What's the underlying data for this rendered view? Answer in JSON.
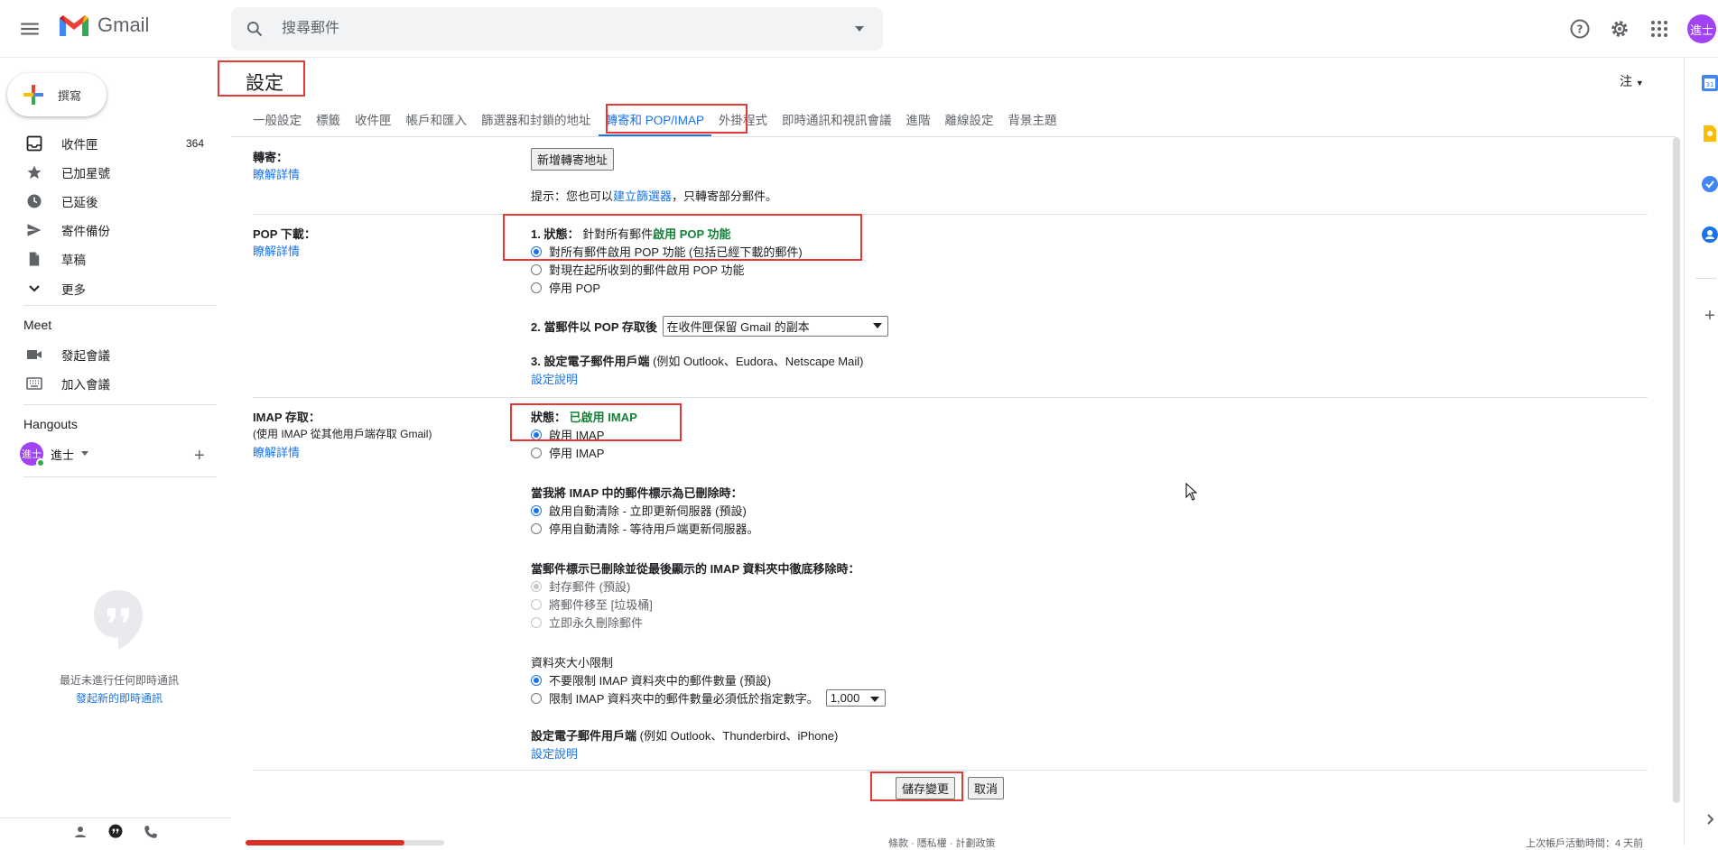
{
  "header": {
    "app_name": "Gmail",
    "search_placeholder": "搜尋郵件",
    "avatar_text": "進士"
  },
  "compose": {
    "label": "撰寫"
  },
  "nav": {
    "items": [
      {
        "label": "收件匣",
        "count": "364",
        "icon": "inbox-icon"
      },
      {
        "label": "已加星號",
        "count": "",
        "icon": "star-icon"
      },
      {
        "label": "已延後",
        "count": "",
        "icon": "clock-icon"
      },
      {
        "label": "寄件備份",
        "count": "",
        "icon": "send-icon"
      },
      {
        "label": "草稿",
        "count": "",
        "icon": "draft-icon"
      },
      {
        "label": "更多",
        "count": "",
        "icon": "chevron-down-icon"
      }
    ],
    "meet_title": "Meet",
    "meet_items": [
      {
        "label": "發起會議",
        "icon": "video-icon"
      },
      {
        "label": "加入會議",
        "icon": "keyboard-icon"
      }
    ],
    "hangouts_title": "Hangouts",
    "hangout_user": "進士",
    "hangout_avatar": "進士",
    "hangout_empty_text": "最近未進行任何即時通訊",
    "hangout_empty_link": "發起新的即時通訊"
  },
  "settings": {
    "title": "設定",
    "lang": "注",
    "tabs": [
      {
        "label": "一般設定"
      },
      {
        "label": "標籤"
      },
      {
        "label": "收件匣"
      },
      {
        "label": "帳戶和匯入"
      },
      {
        "label": "篩選器和封鎖的地址"
      },
      {
        "label": "轉寄和 POP/IMAP",
        "active": true
      },
      {
        "label": "外掛程式"
      },
      {
        "label": "即時通訊和視訊會議"
      },
      {
        "label": "進階"
      },
      {
        "label": "離線設定"
      },
      {
        "label": "背景主題"
      }
    ],
    "learn_more": "瞭解詳情",
    "forwarding": {
      "label": "轉寄：",
      "add_button": "新增轉寄地址",
      "tip_prefix": "提示：您也可以",
      "tip_link": "建立篩選器",
      "tip_suffix": "，只轉寄部分郵件。"
    },
    "pop": {
      "label": "POP 下載：",
      "status_prefix": "1. 狀態：",
      "status_mid": "針對所有郵件",
      "status_value": "啟用 POP 功能",
      "options": [
        {
          "label": "對所有郵件啟用 POP 功能 (包括已經下載的郵件)",
          "selected": true
        },
        {
          "label": "對現在起所收到的郵件啟用 POP 功能",
          "selected": false
        },
        {
          "label": "停用 POP",
          "selected": false
        }
      ],
      "when_prefix": "2. 當郵件以 POP 存取後",
      "when_select": "在收件匣保留 Gmail 的副本",
      "client_bold": "3. 設定電子郵件用戶端",
      "client_rest": "(例如 Outlook、Eudora、Netscape Mail)",
      "config_link": "設定說明"
    },
    "imap": {
      "label": "IMAP 存取：",
      "sub": "(使用 IMAP 從其他用戶端存取 Gmail)",
      "status_prefix": "狀態：",
      "status_value": "已啟用 IMAP",
      "options": [
        {
          "label": "啟用 IMAP",
          "selected": true
        },
        {
          "label": "停用 IMAP",
          "selected": false
        }
      ],
      "deleted_title": "當我將 IMAP 中的郵件標示為已刪除時：",
      "deleted_options": [
        {
          "label": "啟用自動清除 - 立即更新伺服器 (預設)",
          "selected": true
        },
        {
          "label": "停用自動清除 - 等待用戶端更新伺服器。",
          "selected": false
        }
      ],
      "expunge_title": "當郵件標示已刪除並從最後顯示的 IMAP 資料夾中徹底移除時：",
      "expunge_options": [
        {
          "label": "封存郵件 (預設)",
          "selected": true
        },
        {
          "label": "將郵件移至 [垃圾桶]",
          "selected": false
        },
        {
          "label": "立即永久刪除郵件",
          "selected": false
        }
      ],
      "folder_title": "資料夾大小限制",
      "folder_options": [
        {
          "label": "不要限制 IMAP 資料夾中的郵件數量 (預設)",
          "selected": true
        },
        {
          "label": "限制 IMAP 資料夾中的郵件數量必須低於指定數字。",
          "selected": false
        }
      ],
      "folder_select": "1,000",
      "client_bold": "設定電子郵件用戶端",
      "client_rest": "(例如 Outlook、Thunderbird、iPhone)",
      "config_link": "設定說明"
    },
    "save_button": "儲存變更",
    "cancel_button": "取消"
  },
  "footer": {
    "mid": "條款 · 隱私權 · 計劃政策",
    "right": "上次帳戶活動時間：4 天前"
  },
  "colors": {
    "accent": "#1a73e8",
    "green": "#188038",
    "red_box": "#e53935",
    "avatar": "#a142f4"
  }
}
